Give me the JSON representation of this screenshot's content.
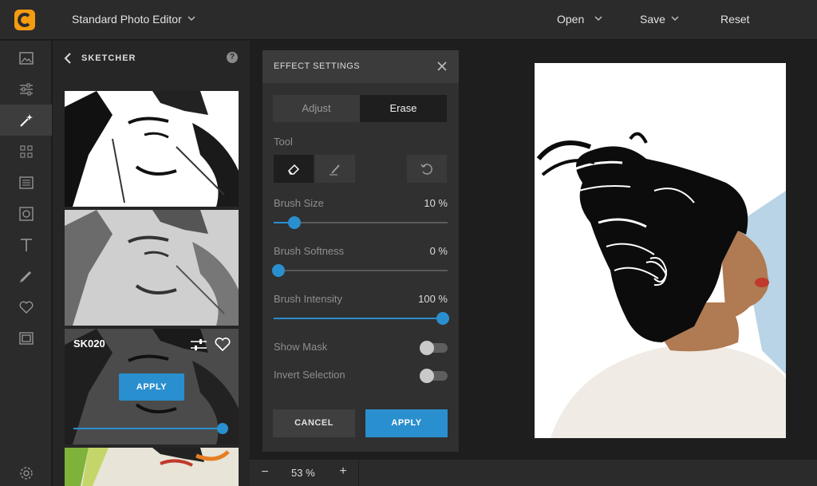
{
  "app": {
    "title": "Standard Photo Editor",
    "brand_color": "#f39c12"
  },
  "menu": {
    "open": "Open",
    "save": "Save",
    "reset": "Reset"
  },
  "toolbar": {
    "items": [
      {
        "icon": "image-icon"
      },
      {
        "icon": "sliders-icon"
      },
      {
        "icon": "magic-wand-icon",
        "active": true
      },
      {
        "icon": "grid-icon"
      },
      {
        "icon": "texture-icon"
      },
      {
        "icon": "frame-icon"
      },
      {
        "icon": "text-icon"
      },
      {
        "icon": "brush-icon"
      },
      {
        "icon": "heart-icon"
      },
      {
        "icon": "border-icon"
      },
      {
        "icon": "settings-icon"
      }
    ]
  },
  "sketcher": {
    "title": "SKETCHER",
    "help": "?",
    "items": [
      {
        "id": "sketch-1"
      },
      {
        "id": "sketch-2"
      },
      {
        "name": "SK020",
        "apply": "APPLY",
        "intensity": 100
      },
      {
        "id": "sketch-4"
      }
    ]
  },
  "effect": {
    "title": "EFFECT SETTINGS",
    "tabs": {
      "adjust": "Adjust",
      "erase": "Erase",
      "active": "Erase"
    },
    "tool_label": "Tool",
    "brush_size": {
      "label": "Brush Size",
      "value": "10 %",
      "fraction": 0.12
    },
    "brush_softness": {
      "label": "Brush Softness",
      "value": "0 %",
      "fraction": 0.0
    },
    "brush_intensity": {
      "label": "Brush Intensity",
      "value": "100 %",
      "fraction": 1.0
    },
    "show_mask": {
      "label": "Show Mask",
      "on": false
    },
    "invert_selection": {
      "label": "Invert Selection",
      "on": false
    },
    "cancel": "CANCEL",
    "apply": "APPLY"
  },
  "zoom": {
    "minus": "−",
    "value": "53 %",
    "plus": "+"
  },
  "colors": {
    "accent": "#2a8fce",
    "panel": "#303030",
    "background": "#1e1e1e"
  }
}
